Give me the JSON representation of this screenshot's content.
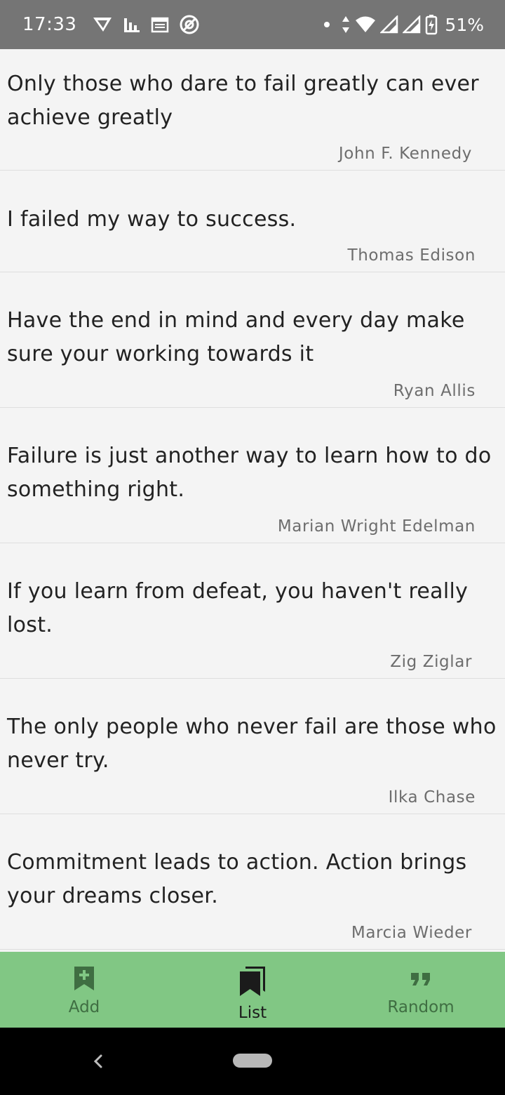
{
  "status_bar": {
    "time": "17:33",
    "battery": "51%",
    "icons": [
      "send-icon",
      "chart-icon",
      "calendar-icon",
      "no-disturb-icon",
      "dot-icon",
      "data-arrows-icon",
      "wifi-icon",
      "signal-icon",
      "signal-icon",
      "battery-charging-icon"
    ]
  },
  "quotes": [
    {
      "text": " Only those who dare to fail greatly can ever achieve greatly",
      "author": "John F. Kennedy"
    },
    {
      "text": " I failed my way to success.",
      "author": "Thomas Edison"
    },
    {
      "text": " Have the end in mind and every day make sure your working towards it",
      "author": "Ryan Allis"
    },
    {
      "text": " Failure is just another way to learn how to do something right.",
      "author": "Marian Wright Edelman"
    },
    {
      "text": " If you learn from defeat, you haven't really lost.",
      "author": "Zig Ziglar"
    },
    {
      "text": " The only people who never fail are those who never try.",
      "author": "Ilka Chase"
    },
    {
      "text": " Commitment leads to action. Action brings your dreams closer.",
      "author": "Marcia Wieder"
    }
  ],
  "bottom_nav": {
    "items": [
      {
        "label": "Add",
        "icon": "bookmark-add-icon",
        "active": false
      },
      {
        "label": "List",
        "icon": "bookmarks-icon",
        "active": true
      },
      {
        "label": "Random",
        "icon": "format-quote-icon",
        "active": false
      }
    ],
    "background": "#81c784",
    "inactive_color": "#3f6e42",
    "active_color": "#1b1b1b"
  }
}
